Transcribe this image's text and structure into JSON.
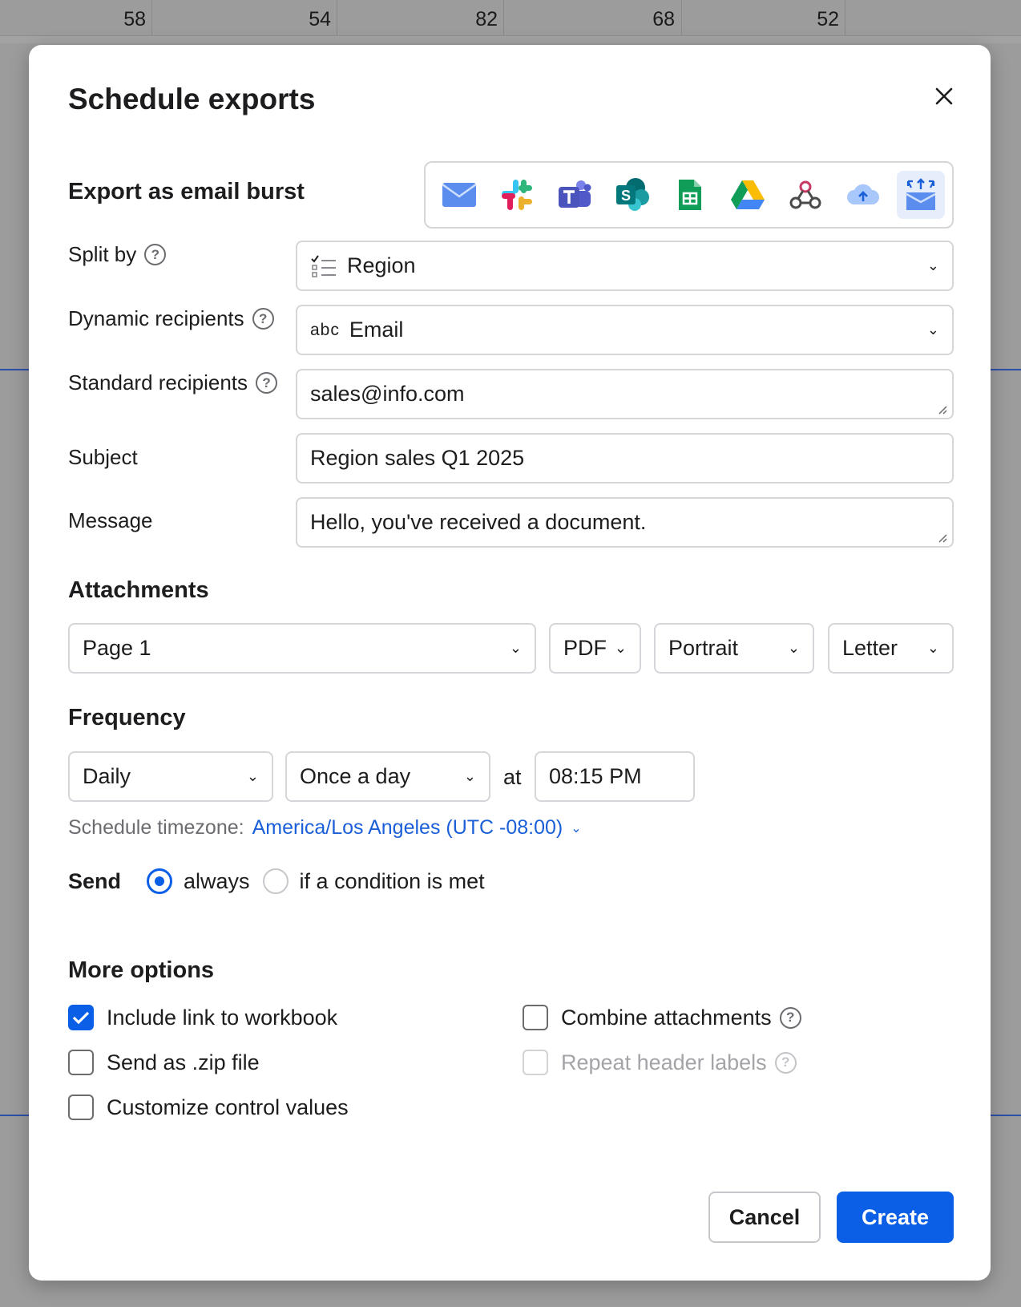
{
  "background": {
    "column_values": [
      "58",
      "54",
      "82",
      "68",
      "52"
    ]
  },
  "dialog": {
    "title": "Schedule exports",
    "export_heading": "Export as email burst",
    "destinations": [
      "email-icon",
      "slack-icon",
      "teams-icon",
      "sharepoint-icon",
      "google-sheets-icon",
      "google-drive-icon",
      "webhook-icon",
      "cloud-upload-icon",
      "email-burst-icon"
    ],
    "split_by": {
      "label": "Split by",
      "value": "Region"
    },
    "dynamic_recipients": {
      "label": "Dynamic recipients",
      "type_tag": "abc",
      "value": "Email"
    },
    "standard_recipients": {
      "label": "Standard recipients",
      "value": "sales@info.com"
    },
    "subject": {
      "label": "Subject",
      "value": "Region sales Q1 2025"
    },
    "message": {
      "label": "Message",
      "value": "Hello, you've received a document."
    },
    "attachments": {
      "heading": "Attachments",
      "page": "Page 1",
      "format": "PDF",
      "orientation": "Portrait",
      "paper": "Letter"
    },
    "frequency": {
      "heading": "Frequency",
      "period": "Daily",
      "times": "Once a day",
      "at_label": "at",
      "time": "08:15 PM",
      "timezone_label": "Schedule timezone:",
      "timezone_value": "America/Los Angeles (UTC -08:00)"
    },
    "send": {
      "label": "Send",
      "option_always": "always",
      "option_condition": "if a condition is met",
      "selected": "always"
    },
    "more_options": {
      "heading": "More options",
      "include_link": {
        "label": "Include link to workbook",
        "checked": true
      },
      "send_zip": {
        "label": "Send as .zip file",
        "checked": false
      },
      "customize_controls": {
        "label": "Customize control values",
        "checked": false
      },
      "combine_attachments": {
        "label": "Combine attachments",
        "checked": false
      },
      "repeat_headers": {
        "label": "Repeat header labels",
        "checked": false,
        "disabled": true
      }
    },
    "buttons": {
      "cancel": "Cancel",
      "create": "Create"
    },
    "colors": {
      "accent": "#0b5ee6",
      "link": "#1a5fd8"
    }
  }
}
